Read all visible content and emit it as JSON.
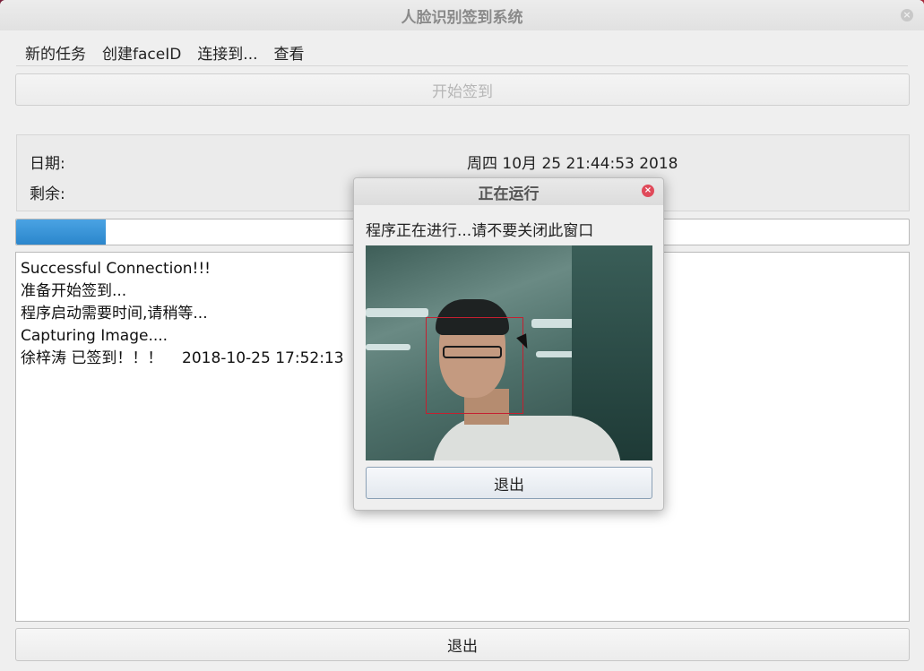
{
  "window": {
    "title": "人脸识别签到系统"
  },
  "menu": {
    "items": [
      "新的任务",
      "创建faceID",
      "连接到...",
      "查看"
    ]
  },
  "start_button": {
    "label": "开始签到"
  },
  "info": {
    "date_label": "日期:",
    "date_value": "周四 10月 25 21:44:53 2018",
    "remaining_label": "剩余:"
  },
  "progress": {
    "fraction": 0.1
  },
  "log": {
    "lines": [
      "Successful Connection!!!",
      "准备开始签到...",
      "程序启动需要时间,请稍等...",
      "Capturing Image....",
      "徐梓涛 已签到！！！    2018-10-25 17:52:13"
    ]
  },
  "exit_button": {
    "label": "退出"
  },
  "dialog": {
    "title": "正在运行",
    "message": "程序正在进行...请不要关闭此窗口",
    "exit_label": "退出"
  },
  "colors": {
    "progress_fill": "#2b86cc",
    "face_box": "#c42030",
    "dialog_close": "#e04a5a"
  }
}
